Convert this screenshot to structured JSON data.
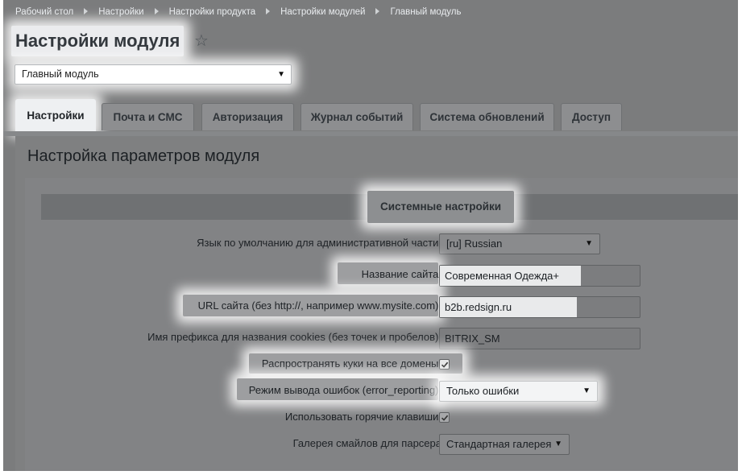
{
  "breadcrumb": [
    "Рабочий стол",
    "Настройки",
    "Настройки продукта",
    "Настройки модулей",
    "Главный модуль"
  ],
  "page_title": "Настройки модуля",
  "module_select": {
    "value": "Главный модуль"
  },
  "tabs": [
    {
      "label": "Настройки",
      "active": true
    },
    {
      "label": "Почта и СМС",
      "active": false
    },
    {
      "label": "Авторизация",
      "active": false
    },
    {
      "label": "Журнал событий",
      "active": false
    },
    {
      "label": "Система обновлений",
      "active": false
    },
    {
      "label": "Доступ",
      "active": false
    }
  ],
  "section_title": "Настройка параметров модуля",
  "system_settings": {
    "title": "Системные настройки",
    "language": {
      "label": "Язык по умолчанию для административной части:",
      "value": "[ru] Russian"
    },
    "site_name": {
      "label": "Название сайта:",
      "value": "Современная Одежда+"
    },
    "site_url": {
      "label": "URL сайта (без http://, например www.mysite.com):",
      "value": "b2b.redsign.ru"
    },
    "cookie_prefix": {
      "label": "Имя префикса для названия cookies (без точек и пробелов):",
      "value": "BITRIX_SM"
    },
    "cookies_all_domains": {
      "label": "Распространять куки на все домены:",
      "checked": true
    },
    "error_reporting": {
      "label": "Режим вывода ошибок (error_reporting):",
      "value": "Только ошибки"
    },
    "hotkeys": {
      "label": "Использовать горячие клавиши:",
      "checked": true
    },
    "smiles_gallery": {
      "label": "Галерея смайлов для парсера",
      "value": "Стандартная галерея"
    }
  },
  "icons": {
    "star": "star-outline-icon",
    "dropdown": "chevron-down-icon",
    "check": "checkmark-icon"
  }
}
